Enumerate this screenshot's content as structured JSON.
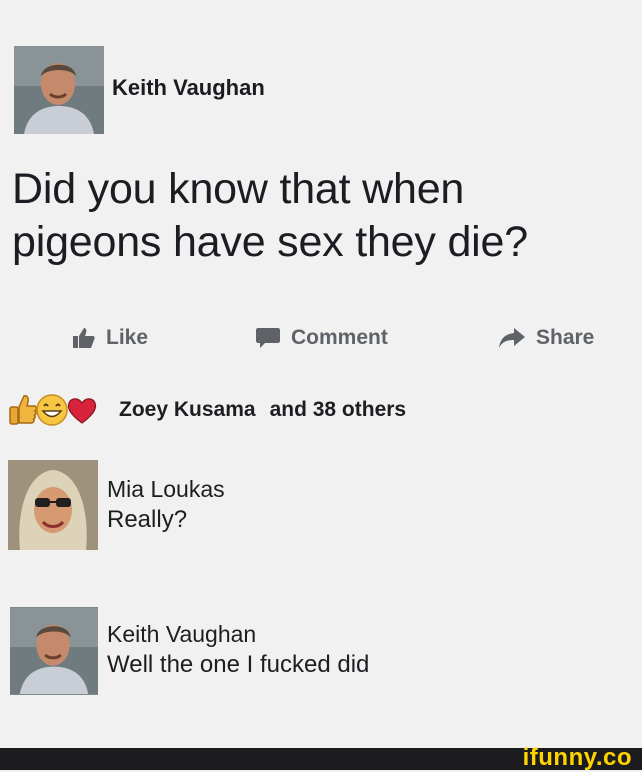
{
  "post": {
    "author": "Keith Vaughan",
    "text_line1": "Did you know that when",
    "text_line2": "pigeons have sex they die?"
  },
  "actions": {
    "like": "Like",
    "comment": "Comment",
    "share": "Share"
  },
  "reactions": {
    "icons": [
      "thumbs-up-icon",
      "grin-icon",
      "heart-icon"
    ],
    "lead_name": "Zoey Kusama",
    "others": "and 38 others"
  },
  "comments": [
    {
      "author": "Mia Loukas",
      "text": "Really?"
    },
    {
      "author": "Keith Vaughan",
      "text": "Well the one I fucked did"
    }
  ],
  "watermark": "ifunny.co",
  "colors": {
    "background": "#f0f1f0",
    "text": "#1d1e22",
    "action_gray": "#5f6368",
    "heart": "#d8243a",
    "watermark_bar": "#1c1c1f",
    "watermark_text": "#ffd400"
  }
}
